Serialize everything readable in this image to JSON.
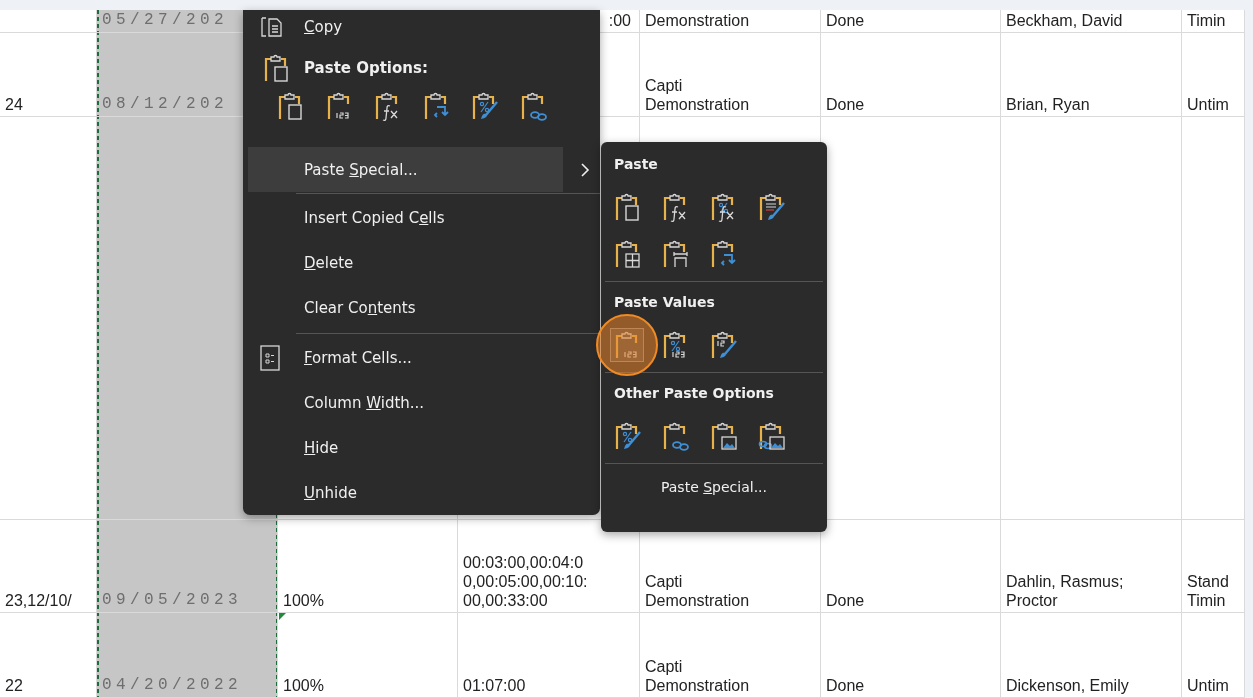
{
  "sheet": {
    "columns": [
      {
        "selected": false
      },
      {
        "selected": true
      },
      {
        "selected": false
      },
      {
        "selected": false
      },
      {
        "selected": false
      },
      {
        "selected": false
      },
      {
        "selected": false
      },
      {
        "selected": false
      }
    ],
    "rows": [
      {
        "column_2": "05/27/202",
        "column_4": ":00",
        "column_5": "Demonstration",
        "column_6": "Done",
        "column_7": "Beckham, David",
        "column_8": "Timin"
      },
      {
        "column_1": "24",
        "column_2": "08/12/202",
        "column_5": "Capti Demonstration",
        "column_6": "Done",
        "column_7": "Brian, Ryan",
        "column_8": "Untim"
      },
      {},
      {
        "column_1": "23,12/10/",
        "column_2": "09/05/2023",
        "column_3": "100%",
        "column_4": "00:03:00,00:04:00,00:05:00,00:10:00,00:33:00",
        "column_5": "Capti Demonstration",
        "column_6": "Done",
        "column_7": "Dahlin, Rasmus; Proctor",
        "column_8": "Stand Timin"
      },
      {
        "column_1": "22",
        "column_2": "04/20/2022",
        "column_3": {
          "text": "100%",
          "error_mark": true
        },
        "column_4": "01:07:00",
        "column_5": "Capti Demonstration",
        "column_6": "Done",
        "column_7": "Dickenson, Emily",
        "column_8": "Untim"
      }
    ]
  },
  "context_menu": {
    "items": [
      {
        "kind": "item",
        "selected": false,
        "label_parts": [
          {
            "text": "C",
            "underlined": true
          },
          {
            "text": "opy",
            "underlined": false
          }
        ]
      },
      {
        "kind": "heading",
        "label_parts": [
          {
            "text": "Paste Options:",
            "underlined": false
          }
        ]
      },
      {
        "kind": "icons",
        "icons": [
          {
            "kind": "paste",
            "selected": false
          },
          {
            "kind": "values",
            "selected": false
          },
          {
            "kind": "formulas",
            "selected": false
          },
          {
            "kind": "transpose",
            "selected": false
          },
          {
            "kind": "formatting",
            "selected": false
          },
          {
            "kind": "link",
            "selected": false
          }
        ]
      },
      {
        "kind": "submenu",
        "selected": true,
        "label_parts": [
          {
            "text": "Paste ",
            "underlined": false
          },
          {
            "text": "S",
            "underlined": true
          },
          {
            "text": "pecial...",
            "underlined": false
          }
        ]
      },
      {
        "kind": "divider"
      },
      {
        "kind": "item",
        "selected": false,
        "label_parts": [
          {
            "text": "Insert Copied C",
            "underlined": false
          },
          {
            "text": "e",
            "underlined": true
          },
          {
            "text": "lls",
            "underlined": false
          }
        ]
      },
      {
        "kind": "item",
        "selected": false,
        "label_parts": [
          {
            "text": "D",
            "underlined": true
          },
          {
            "text": "elete",
            "underlined": false
          }
        ]
      },
      {
        "kind": "item",
        "selected": false,
        "label_parts": [
          {
            "text": "Clear Co",
            "underlined": false
          },
          {
            "text": "n",
            "underlined": true
          },
          {
            "text": "tents",
            "underlined": false
          }
        ]
      },
      {
        "kind": "divider"
      },
      {
        "kind": "item",
        "selected": false,
        "label_parts": [
          {
            "text": "F",
            "underlined": true
          },
          {
            "text": "ormat Cells...",
            "underlined": false
          }
        ]
      },
      {
        "kind": "item",
        "selected": false,
        "label_parts": [
          {
            "text": "Column ",
            "underlined": false
          },
          {
            "text": "W",
            "underlined": true
          },
          {
            "text": "idth...",
            "underlined": false
          }
        ]
      },
      {
        "kind": "item",
        "selected": false,
        "label_parts": [
          {
            "text": "H",
            "underlined": true
          },
          {
            "text": "ide",
            "underlined": false
          }
        ]
      },
      {
        "kind": "item",
        "selected": false,
        "label_parts": [
          {
            "text": "U",
            "underlined": true
          },
          {
            "text": "nhide",
            "underlined": false
          }
        ]
      }
    ]
  },
  "paste_submenu": {
    "groups": [
      {
        "heading": "Paste",
        "icons": [
          {
            "kind": "paste",
            "selected": false
          },
          {
            "kind": "formulas",
            "selected": false
          },
          {
            "kind": "formulas_number_format",
            "selected": false
          },
          {
            "kind": "keep_source_formatting",
            "selected": false
          },
          {
            "kind": "borders",
            "selected": false
          },
          {
            "kind": "column_widths",
            "selected": false
          },
          {
            "kind": "transpose",
            "selected": false
          }
        ]
      },
      {
        "heading": "Paste Values",
        "icons": [
          {
            "kind": "values",
            "selected": true
          },
          {
            "kind": "values_number_format",
            "selected": false
          },
          {
            "kind": "values_source_formatting",
            "selected": false
          }
        ]
      },
      {
        "heading": "Other Paste Options",
        "icons": [
          {
            "kind": "formatting",
            "selected": false
          },
          {
            "kind": "link",
            "selected": false
          },
          {
            "kind": "picture",
            "selected": false
          },
          {
            "kind": "linked_picture",
            "selected": false
          }
        ]
      }
    ],
    "footer": {
      "label_parts": [
        {
          "text": "Paste ",
          "underlined": false
        },
        {
          "text": "S",
          "underlined": true
        },
        {
          "text": "pecial...",
          "underlined": false
        }
      ]
    }
  }
}
